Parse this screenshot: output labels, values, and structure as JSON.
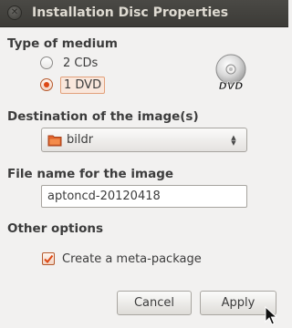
{
  "window": {
    "title": "Installation Disc Properties"
  },
  "medium": {
    "label": "Type of medium",
    "options": [
      {
        "label": "2 CDs",
        "selected": false
      },
      {
        "label": "1 DVD",
        "selected": true
      }
    ],
    "icon": "dvd-disc-icon",
    "icon_text": "DVD"
  },
  "destination": {
    "label": "Destination of the image(s)",
    "value": "bildr",
    "icon": "folder-icon"
  },
  "filename": {
    "label": "File name for the image",
    "value": "aptoncd-20120418"
  },
  "other": {
    "label": "Other options",
    "meta_package": {
      "label": "Create a meta-package",
      "checked": true
    }
  },
  "buttons": {
    "cancel": "Cancel",
    "apply": "Apply"
  },
  "colors": {
    "accent": "#dd4814",
    "titlebar": "#3c3b37",
    "background": "#f2f1f0"
  }
}
